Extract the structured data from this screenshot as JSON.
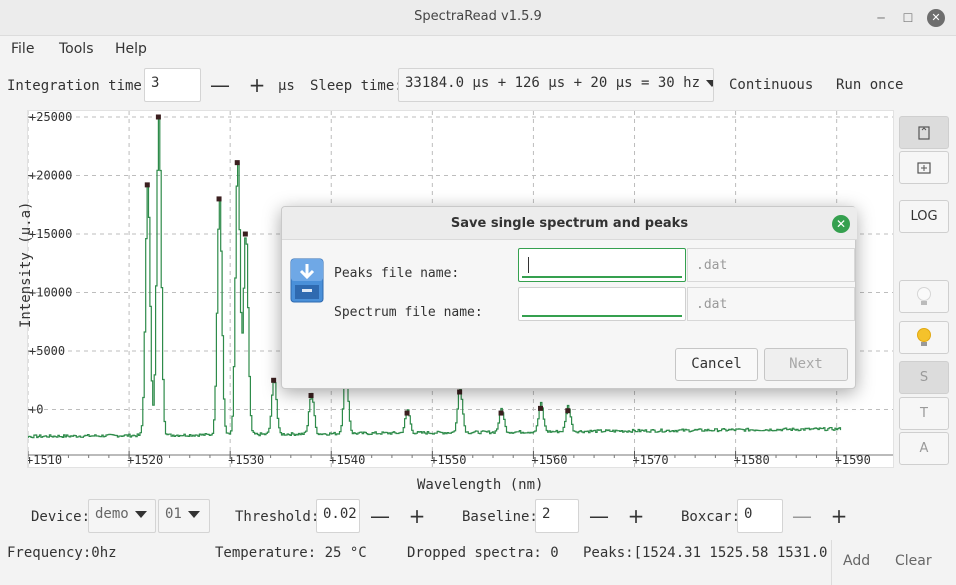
{
  "window": {
    "title": "SpectraRead v1.5.9"
  },
  "menu": [
    "File",
    "Tools",
    "Help"
  ],
  "toolbar": {
    "integration_label": "Integration time:",
    "integration_value": "3",
    "minus": "—",
    "plus": "+",
    "unit": "µs",
    "sleep_label": "Sleep time:",
    "sleep_value": "33184.0 µs + 126 µs + 20 µs = 30 hz",
    "continuous": "Continuous",
    "run_once": "Run once"
  },
  "chart_data": {
    "type": "line",
    "xlabel": "Wavelength (nm)",
    "ylabel": "Intensity (u.a)",
    "xlim": [
      1510,
      1593
    ],
    "ylim": [
      -3200,
      25000
    ],
    "x_ticks": [
      "+1510",
      "+1520",
      "+1530",
      "+1540",
      "+1550",
      "+1560",
      "+1570",
      "+1580",
      "+1590"
    ],
    "x_tick_values": [
      1510,
      1520,
      1530,
      1540,
      1550,
      1560,
      1570,
      1580,
      1590
    ],
    "y_ticks": [
      "+0",
      "+5000",
      "+10000",
      "+15000",
      "+20000",
      "+25000"
    ],
    "y_tick_values": [
      0,
      5000,
      10000,
      15000,
      20000,
      25000
    ],
    "grid": true,
    "series_color": "#2e8b4a",
    "baseline": -2300,
    "peaks": [
      {
        "x": 1521.8,
        "y": 19200
      },
      {
        "x": 1522.9,
        "y": 25000
      },
      {
        "x": 1530.7,
        "y": 21100
      },
      {
        "x": 1528.9,
        "y": 18000
      },
      {
        "x": 1531.5,
        "y": 15000
      },
      {
        "x": 1534.3,
        "y": 2500
      },
      {
        "x": 1538.0,
        "y": 1200
      },
      {
        "x": 1541.4,
        "y": 3000
      },
      {
        "x": 1547.5,
        "y": -300
      },
      {
        "x": 1552.7,
        "y": 1500
      },
      {
        "x": 1556.8,
        "y": -300
      },
      {
        "x": 1560.7,
        "y": 100
      },
      {
        "x": 1563.4,
        "y": -100
      }
    ]
  },
  "sidebar": {
    "log": "LOG",
    "s": "S",
    "t": "T",
    "a": "A"
  },
  "bottom": {
    "device_label": "Device:",
    "device_value": "demo",
    "device_index": "01",
    "threshold_label": "Threshold:",
    "threshold_value": "0.02",
    "baseline_label": "Baseline:",
    "baseline_value": "2",
    "boxcar_label": "Boxcar:",
    "boxcar_value": "0",
    "minus": "—",
    "plus": "+"
  },
  "status": {
    "frequency": "Frequency:0hz",
    "temperature": "Temperature: 25 °C",
    "dropped": "Dropped spectra: 0",
    "peaks": "Peaks:[1524.31  1525.58  1531.0",
    "add": "Add",
    "clear": "Clear"
  },
  "dialog": {
    "title": "Save single spectrum and peaks",
    "peaks_label": "Peaks file name:",
    "spectrum_label": "Spectrum file name:",
    "peaks_value": "",
    "spectrum_value": "",
    "suffix": ".dat",
    "cancel": "Cancel",
    "next": "Next"
  }
}
